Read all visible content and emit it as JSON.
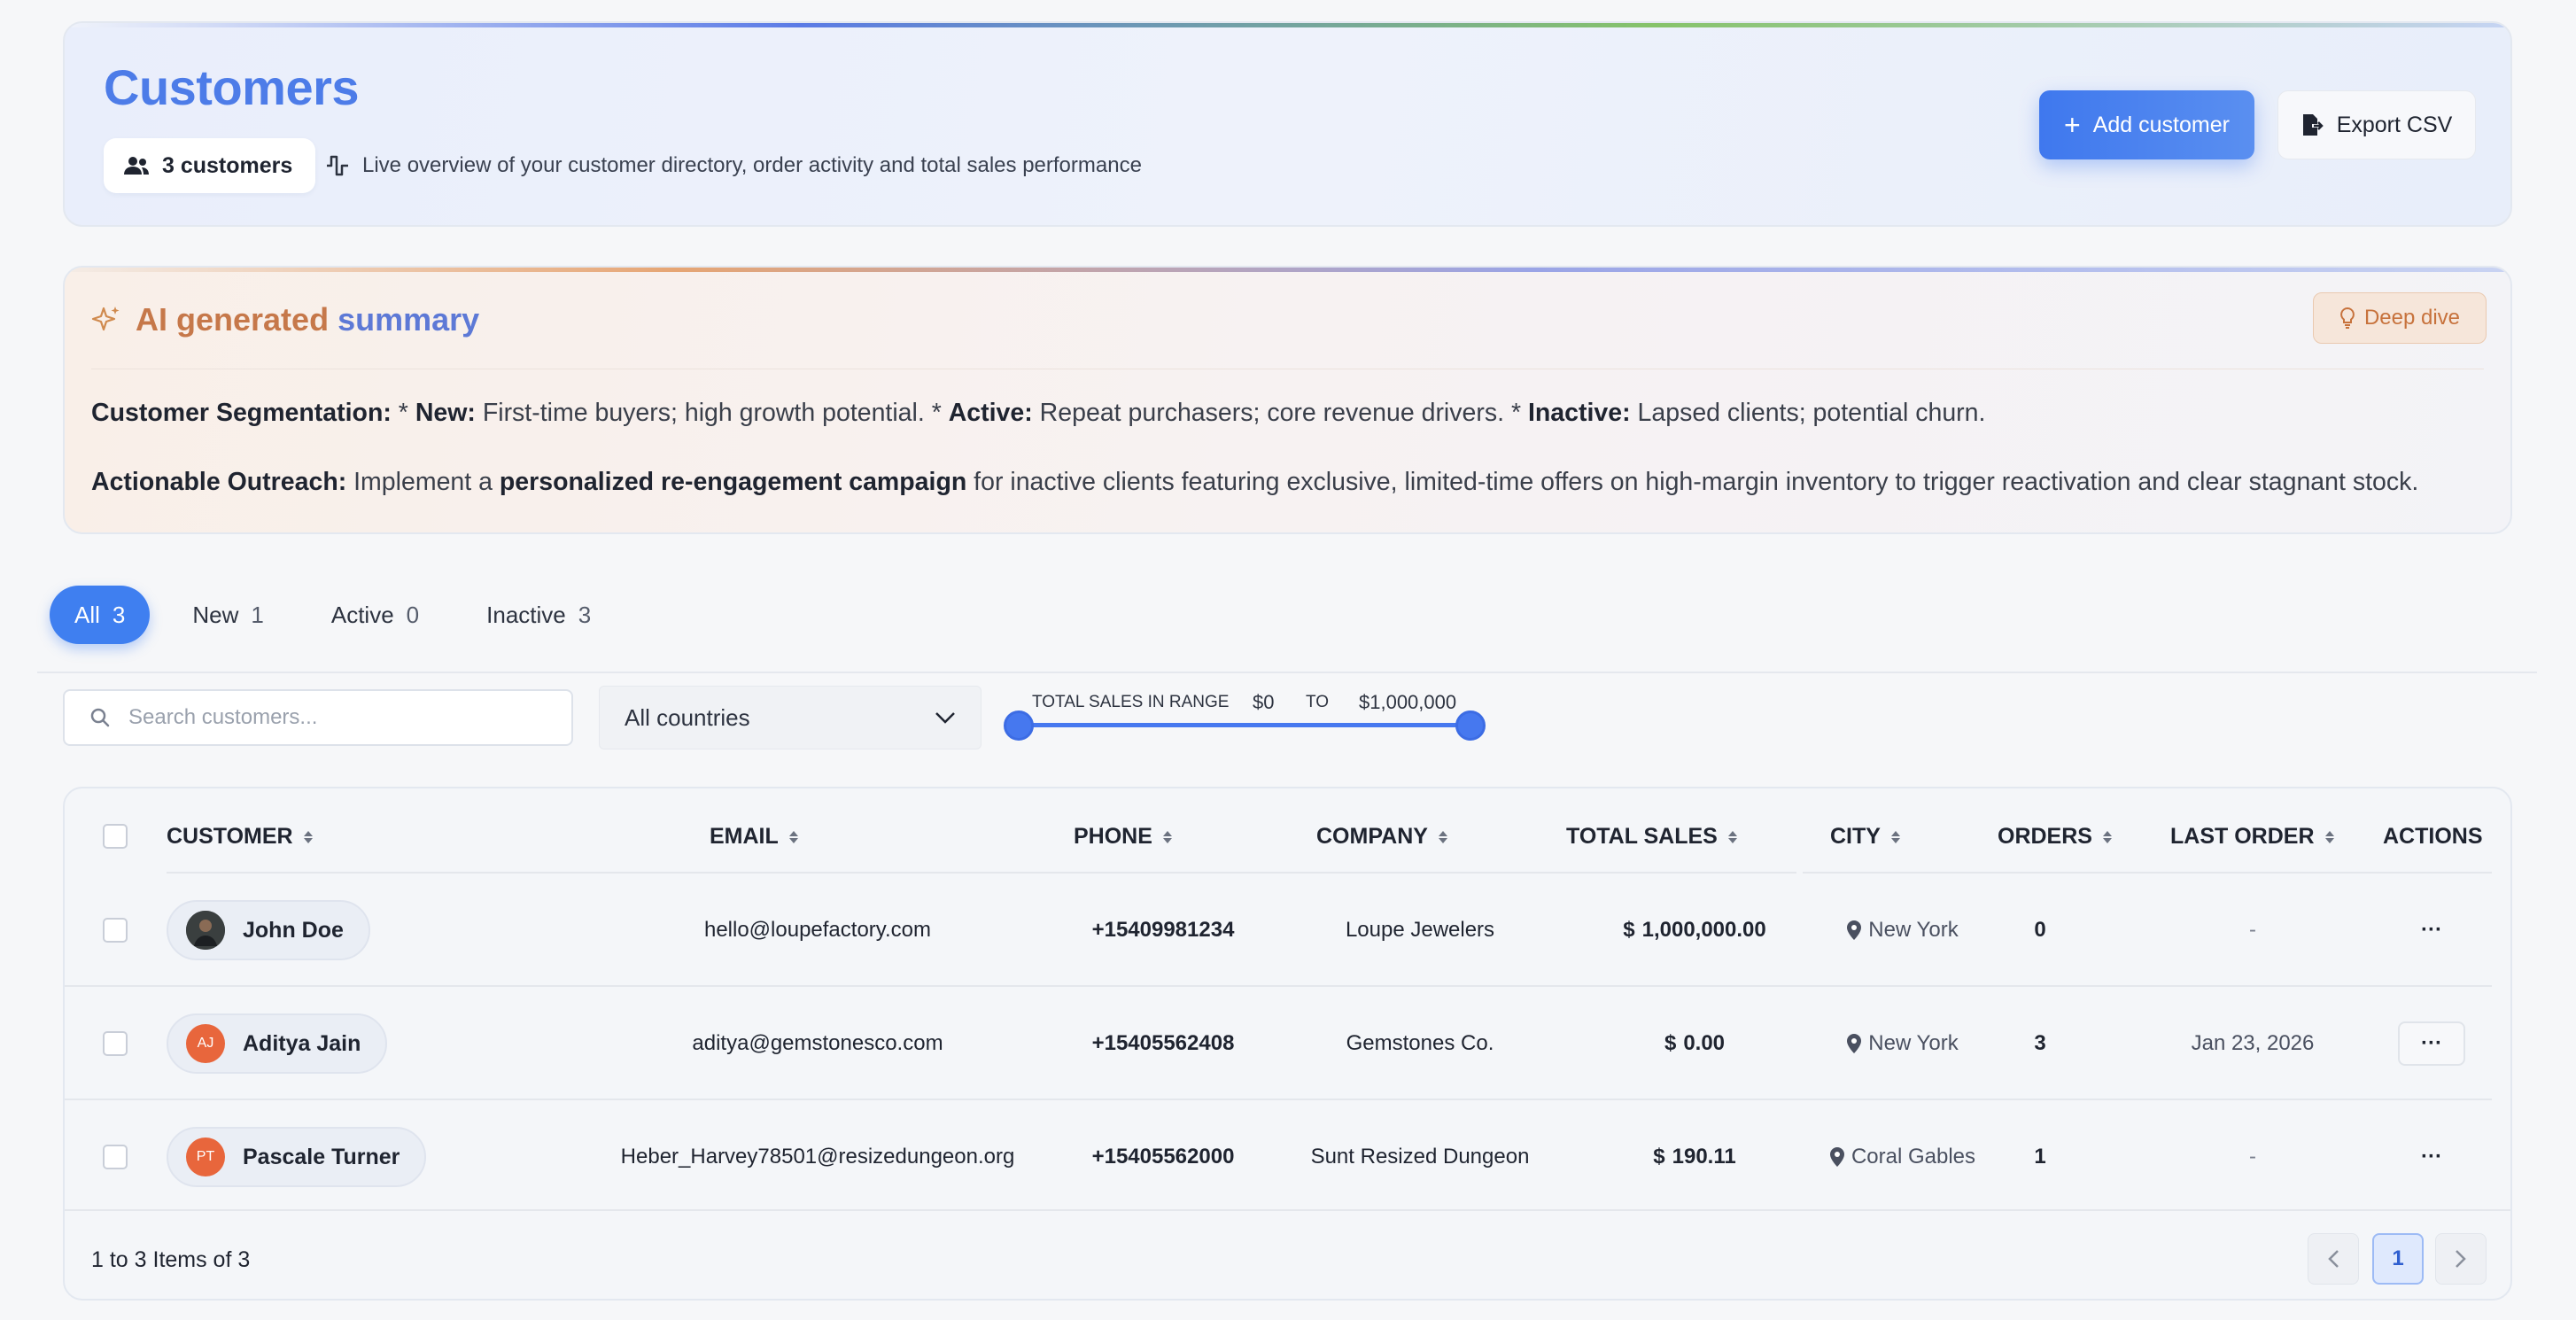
{
  "header": {
    "title": "Customers",
    "count_label": "3 customers",
    "subtitle": "Live overview of your customer directory, order activity and total sales performance",
    "add_button": "Add customer",
    "export_button": "Export CSV"
  },
  "ai_summary": {
    "title_part1": "AI generated",
    "title_part2": "summary",
    "deep_dive": "Deep dive",
    "p1": {
      "b1": "Customer Segmentation:",
      "t1": " * ",
      "b2": "New:",
      "t2": " First-time buyers; high growth potential. * ",
      "b3": "Active:",
      "t3": " Repeat purchasers; core revenue drivers. * ",
      "b4": "Inactive:",
      "t4": " Lapsed clients; potential churn."
    },
    "p2": {
      "b1": "Actionable Outreach:",
      "t1": " Implement a ",
      "b2": "personalized re-engagement campaign",
      "t2": " for inactive clients featuring exclusive, limited-time offers on high-margin inventory to trigger reactivation and clear stagnant stock."
    }
  },
  "tabs": [
    {
      "label": "All",
      "count": "3"
    },
    {
      "label": "New",
      "count": "1"
    },
    {
      "label": "Active",
      "count": "0"
    },
    {
      "label": "Inactive",
      "count": "3"
    }
  ],
  "filters": {
    "search_placeholder": "Search customers...",
    "country_selected": "All countries",
    "range_label": "TOTAL SALES IN RANGE",
    "range_min": "$0",
    "range_to": "TO",
    "range_max": "$1,000,000"
  },
  "table": {
    "columns": [
      "CUSTOMER",
      "EMAIL",
      "PHONE",
      "COMPANY",
      "TOTAL SALES",
      "CITY",
      "ORDERS",
      "LAST ORDER",
      "ACTIONS"
    ],
    "rows": [
      {
        "name": "John Doe",
        "initials": "",
        "email": "hello@loupefactory.com",
        "phone": "+15409981234",
        "company": "Loupe Jewelers",
        "currency": "$",
        "sales": "1,000,000.00",
        "city": "New York",
        "orders": "0",
        "last_order": "-",
        "actions": "···"
      },
      {
        "name": "Aditya Jain",
        "initials": "AJ",
        "email": "aditya@gemstonesco.com",
        "phone": "+15405562408",
        "company": "Gemstones Co.",
        "currency": "$",
        "sales": "0.00",
        "city": "New York",
        "orders": "3",
        "last_order": "Jan 23, 2026",
        "actions": "···"
      },
      {
        "name": "Pascale Turner",
        "initials": "PT",
        "email": "Heber_Harvey78501@resizedungeon.org",
        "phone": "+15405562000",
        "company": "Sunt Resized Dungeon",
        "currency": "$",
        "sales": "190.11",
        "city": "Coral Gables",
        "orders": "1",
        "last_order": "-",
        "actions": "···"
      }
    ],
    "footer": "1 to 3 Items of 3",
    "current_page": "1"
  },
  "colors": {
    "accent": "#3f7ff0",
    "title_blue": "#4d7ce8",
    "ai_orange": "#c6784a",
    "avatar_orange": "#e8663c"
  }
}
